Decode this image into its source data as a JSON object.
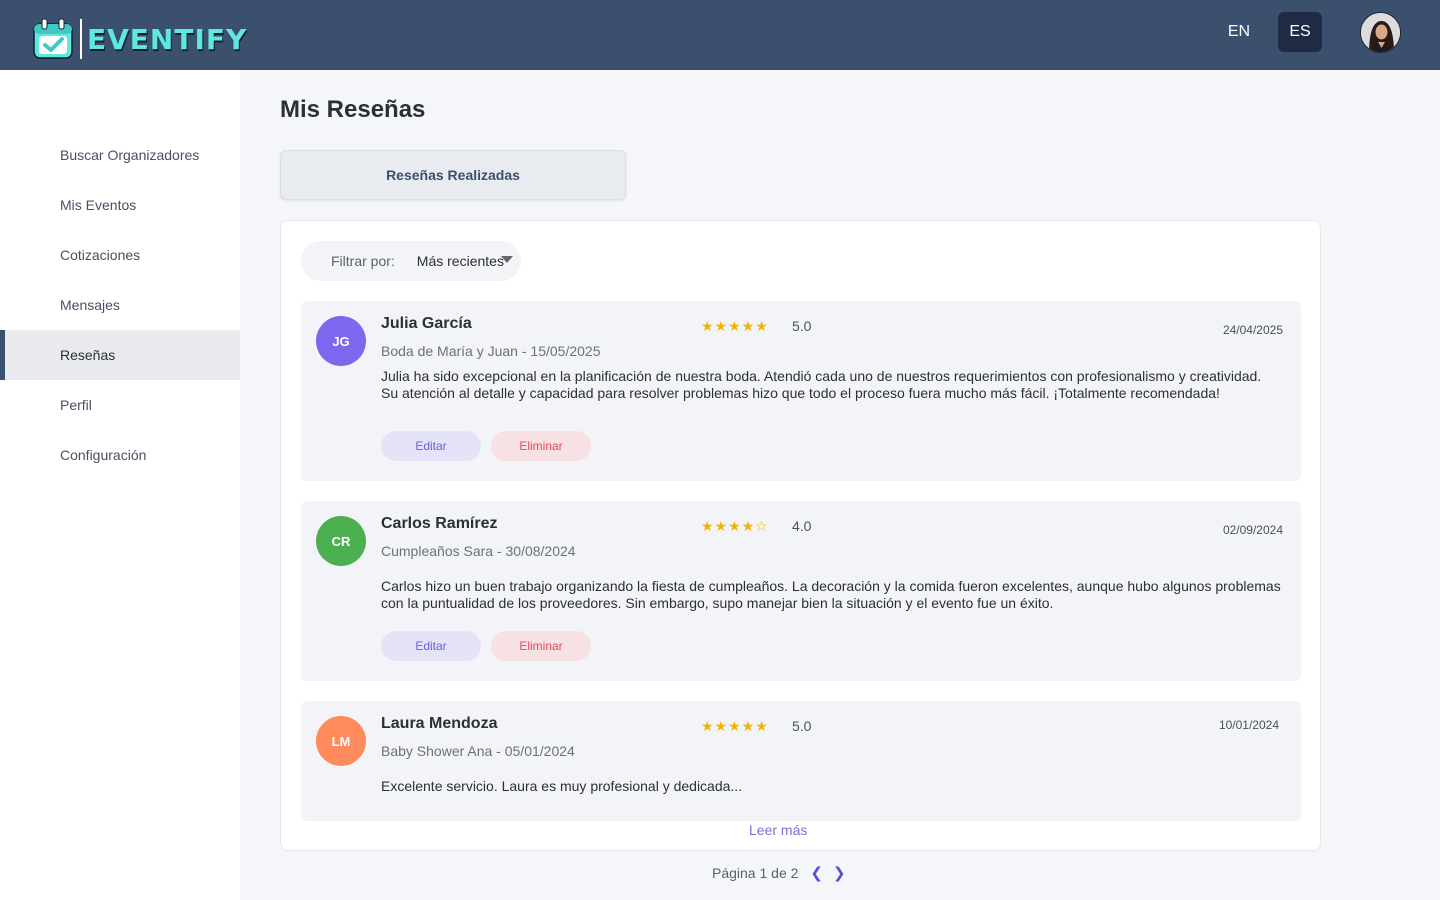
{
  "app": {
    "name": "EVENTIFY"
  },
  "header": {
    "lang_en": "EN",
    "lang_es": "ES",
    "active_lang": "ES"
  },
  "sidebar": {
    "items": [
      {
        "label": "Buscar Organizadores"
      },
      {
        "label": "Mis Eventos"
      },
      {
        "label": "Cotizaciones"
      },
      {
        "label": "Mensajes"
      },
      {
        "label": "Reseñas"
      },
      {
        "label": "Perfil"
      },
      {
        "label": "Configuración"
      }
    ],
    "active": "Reseñas"
  },
  "main": {
    "title": "Mis Reseñas",
    "tab_label": "Reseñas Realizadas",
    "filter": {
      "label": "Filtrar por:",
      "selected": "Más recientes"
    },
    "reviews": [
      {
        "initials": "JG",
        "avatar_color": "#7b68ee",
        "name": "Julia García",
        "event": "Boda de María y Juan - 15/05/2025",
        "stars": "★★★★★",
        "rating": "5.0",
        "date": "24/04/2025",
        "text": "Julia ha sido excepcional en la planificación de nuestra boda. Atendió cada uno de nuestros requerimientos con profesionalismo y creatividad. Su atención al detalle y capacidad para resolver problemas hizo que todo el proceso fuera mucho más fácil. ¡Totalmente recomendada!",
        "edit_label": "Editar",
        "delete_label": "Eliminar"
      },
      {
        "initials": "CR",
        "avatar_color": "#4caf50",
        "name": "Carlos Ramírez",
        "event": "Cumpleaños Sara - 30/08/2024",
        "stars": "★★★★☆",
        "rating": "4.0",
        "date": "02/09/2024",
        "text": "Carlos hizo un buen trabajo organizando la fiesta de cumpleaños. La decoración y la comida fueron excelentes, aunque hubo algunos problemas con la puntualidad de los proveedores. Sin embargo, supo manejar bien la situación y el evento fue un éxito.",
        "edit_label": "Editar",
        "delete_label": "Eliminar"
      },
      {
        "initials": "LM",
        "avatar_color": "#ff8a5c",
        "name": "Laura Mendoza",
        "event": "Baby Shower Ana - 05/01/2024",
        "stars": "★★★★★",
        "rating": "5.0",
        "date": "10/01/2024",
        "text": "Excelente servicio. Laura es muy profesional y dedicada..."
      }
    ],
    "read_more": "Leer más",
    "pagination": {
      "text": "Página 1 de 2",
      "prev": "❮",
      "next": "❯"
    }
  },
  "colors": {
    "header_bg": "#3b506c",
    "accent": "#6a5fd6",
    "danger": "#e04a5a",
    "logo": "#5ee8e0"
  }
}
